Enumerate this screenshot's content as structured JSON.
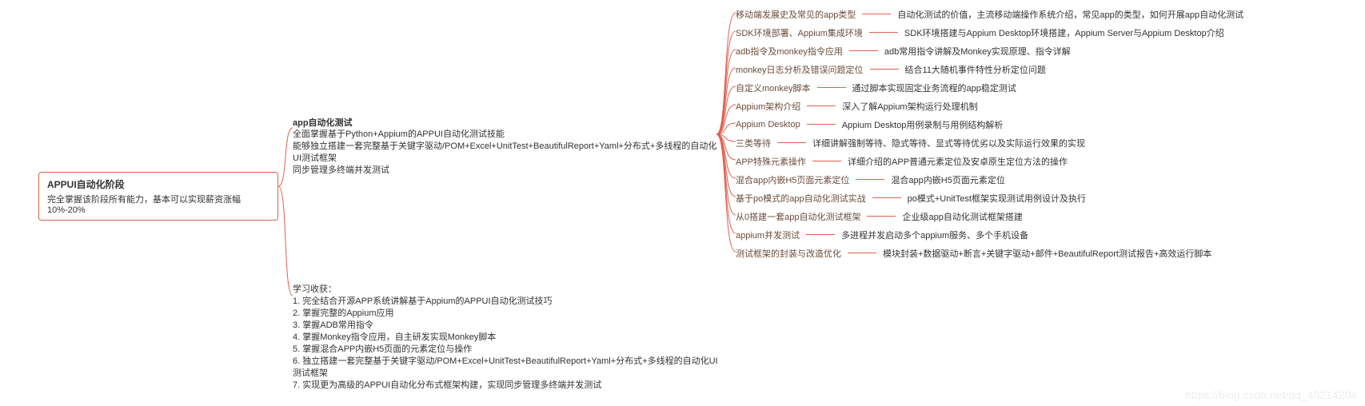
{
  "root": {
    "title": "APPUI自动化阶段",
    "subtitle": "完全掌握该阶段所有能力，基本可以实现薪资涨幅10%-20%"
  },
  "mid": {
    "title": "app自动化测试",
    "line1": "全面掌握基于Python+Appium的APPUI自动化测试技能",
    "line2": "能够独立搭建一套完整基于关键字驱动/POM+Excel+UnitTest+BeautifulReport+Yaml+分布式+多线程的自动化UI测试框架",
    "line3": "同步管理多终端并发测试"
  },
  "gains": {
    "title": "学习收获：",
    "items": [
      "1. 完全结合开源APP系统讲解基于Appium的APPUI自动化测试技巧",
      "2. 掌握完整的Appium应用",
      "3. 掌握ADB常用指令",
      "4. 掌握Monkey指令应用，自主研发实现Monkey脚本",
      "5. 掌握混合APP内嵌H5页面的元素定位与操作",
      "6. 独立搭建一套完整基于关键字驱动/POM+Excel+UnitTest+BeautifulReport+Yaml+分布式+多线程的自动化UI测试框架",
      "7. 实现更为高级的APPUI自动化分布式框架构建，实现同步管理多终端并发测试"
    ]
  },
  "right": [
    {
      "topic": "移动端发展史及常见的app类型",
      "detail": "自动化测试的价值，主流移动端操作系统介绍，常见app的类型，如何开展app自动化测试"
    },
    {
      "topic": "SDK环境部署、Appium集成环境",
      "detail": "SDK环境搭建与Appium Desktop环境搭建，Appium Server与Appium Desktop介绍"
    },
    {
      "topic": "adb指令及monkey指令应用",
      "detail": "adb常用指令讲解及Monkey实现原理、指令详解"
    },
    {
      "topic": "monkey日志分析及错误问题定位",
      "detail": "结合11大随机事件特性分析定位问题"
    },
    {
      "topic": "自定义monkey脚本",
      "detail": "通过脚本实现固定业务流程的app稳定测试"
    },
    {
      "topic": "Appium架构介绍",
      "detail": "深入了解Appium架构运行处理机制"
    },
    {
      "topic": "Appium Desktop",
      "detail": "Appium Desktop用例录制与用例结构解析"
    },
    {
      "topic": "三类等待",
      "detail": "详细讲解强制等待、隐式等待、显式等待优劣以及实际运行效果的实现"
    },
    {
      "topic": "APP特殊元素操作",
      "detail": "详细介绍的APP普通元素定位及安卓原生定位方法的操作"
    },
    {
      "topic": "混合app内嵌H5页面元素定位",
      "detail": "混合app内嵌H5页面元素定位"
    },
    {
      "topic": "基于po模式的app自动化测试实战",
      "detail": "po模式+UnitTest框架实现测试用例设计及执行"
    },
    {
      "topic": "从0搭建一套app自动化测试框架",
      "detail": "企业级app自动化测试框架搭建"
    },
    {
      "topic": "appium并发测试",
      "detail": "多进程并发启动多个appium服务、多个手机设备"
    },
    {
      "topic": "测试框架的封装与改造优化",
      "detail": "模块封装+数据驱动+断言+关键字驱动+邮件+BeautifulReport测试报告+高效运行脚本"
    }
  ],
  "watermark": "https://blog.csdn.net/qq_40214204"
}
